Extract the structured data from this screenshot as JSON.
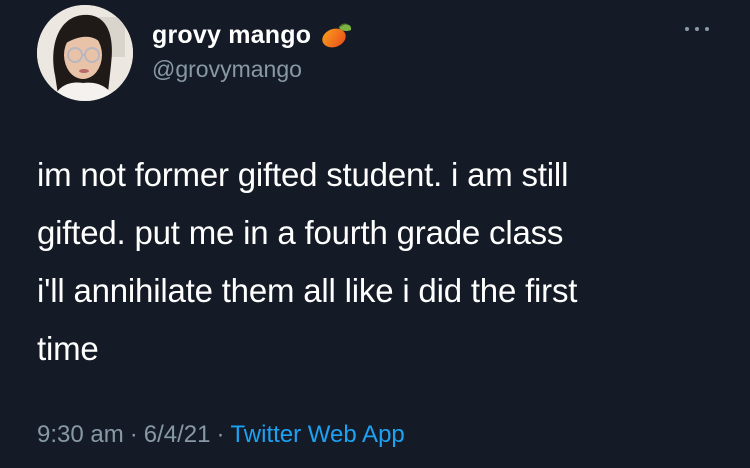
{
  "user": {
    "display_name": "grovy mango",
    "handle": "@grovymango",
    "name_emoji_icon": "mango-emoji-icon",
    "avatar_icon": "avatar"
  },
  "tweet": {
    "text": "im not former gifted student. i am still\ngifted. put me in a fourth grade class\ni'll annihilate them all like i did the first\ntime",
    "time": "9:30 am",
    "date": "6/4/21",
    "separator": "·",
    "source": "Twitter Web App"
  },
  "icons": {
    "more": "more-options-icon"
  },
  "colors": {
    "background": "#141b26",
    "text": "#ffffff",
    "secondary": "#8899a6",
    "link": "#1da1f2"
  }
}
